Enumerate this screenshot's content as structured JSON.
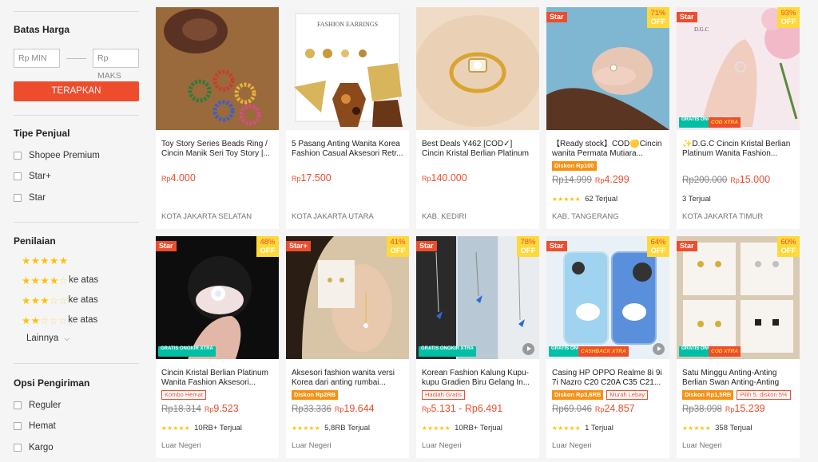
{
  "sidebar": {
    "price_section": {
      "title": "Batas Harga",
      "min_placeholder": "Rp MIN",
      "max_placeholder": "Rp MAKS",
      "apply_label": "TERAPKAN"
    },
    "seller_section": {
      "title": "Tipe Penjual",
      "options": [
        "Shopee Premium",
        "Star+",
        "Star"
      ]
    },
    "rating_section": {
      "title": "Penilaian",
      "options": [
        {
          "stars": 5,
          "suffix": ""
        },
        {
          "stars": 4,
          "suffix": "ke atas"
        },
        {
          "stars": 3,
          "suffix": "ke atas"
        },
        {
          "stars": 2,
          "suffix": "ke atas"
        }
      ],
      "more_label": "Lainnya"
    },
    "shipping_section": {
      "title": "Opsi Pengiriman",
      "options": [
        "Reguler",
        "Hemat",
        "Kargo"
      ]
    }
  },
  "products": [
    {
      "title": "Toy Story Series Beads Ring / Cincin Manik Seri Toy Story |...",
      "price": "4.000",
      "old_price": "",
      "currency": "Rp",
      "location": "KOTA JAKARTA SELATAN",
      "seller_badge": "",
      "discount": "",
      "discount_suffix": "",
      "tags": [],
      "sold": "",
      "rating_stars": 0,
      "free_shipping": false,
      "cod_tag": "",
      "has_video": false
    },
    {
      "title": "5 Pasang Anting Wanita Korea Fashion Casual Aksesori Retr...",
      "price": "17.500",
      "old_price": "",
      "currency": "Rp",
      "location": "KOTA JAKARTA UTARA",
      "seller_badge": "",
      "discount": "",
      "discount_suffix": "",
      "tags": [],
      "sold": "",
      "rating_stars": 0,
      "free_shipping": false,
      "cod_tag": "",
      "has_video": false,
      "image_text": "FASHION EARRINGS"
    },
    {
      "title": "Best Deals Y462 [COD✓] Cincin Kristal Berlian Platinum Wanit...",
      "price": "140.000",
      "old_price": "",
      "currency": "Rp",
      "location": "KAB. KEDIRI",
      "seller_badge": "",
      "discount": "",
      "discount_suffix": "",
      "tags": [],
      "sold": "",
      "rating_stars": 0,
      "free_shipping": false,
      "cod_tag": "",
      "has_video": false
    },
    {
      "title": "【Ready stock】COD🟡Cincin wanita Permata Mutiara...",
      "price": "4.299",
      "old_price": "Rp14.999",
      "currency": "Rp",
      "location": "KAB. TANGERANG",
      "seller_badge": "Star",
      "discount": "71%",
      "discount_suffix": "OFF",
      "tags": [
        {
          "text": "Diskon Rp100",
          "style": "fill"
        }
      ],
      "sold": "62 Terjual",
      "rating_stars": 5,
      "free_shipping": false,
      "cod_tag": "",
      "has_video": false
    },
    {
      "title": "✨D.G.C Cincin Kristal Berlian Platinum Wanita Fashion...",
      "price": "15.000",
      "old_price": "Rp200.000",
      "currency": "Rp",
      "location": "KOTA JAKARTA TIMUR",
      "seller_badge": "Star",
      "discount": "93%",
      "discount_suffix": "OFF",
      "tags": [],
      "sold": "3 Terjual",
      "rating_stars": 0,
      "free_shipping": true,
      "cod_tag": "COD XTRA",
      "has_video": false,
      "image_text": "D.G.C"
    },
    {
      "title": "Cincin Kristal Berlian Platinum Wanita Fashion Aksesori...",
      "price": "9.523",
      "old_price": "Rp18.314",
      "currency": "Rp",
      "location": "Luar Negeri",
      "seller_badge": "Star",
      "discount": "48%",
      "discount_suffix": "OFF",
      "tags": [
        {
          "text": "Kombo Hemat",
          "style": "outline"
        }
      ],
      "sold": "10RB+ Terjual",
      "rating_stars": 5,
      "free_shipping": true,
      "cod_tag": "",
      "has_video": false
    },
    {
      "title": "Aksesori fashion wanita versi Korea dari anting rumbai...",
      "price": "19.644",
      "old_price": "Rp33.336",
      "currency": "Rp",
      "location": "Luar Negeri",
      "seller_badge": "Star+",
      "discount": "41%",
      "discount_suffix": "OFF",
      "tags": [
        {
          "text": "Diskon Rp2RB",
          "style": "fill"
        }
      ],
      "sold": "5,8RB Terjual",
      "rating_stars": 5,
      "free_shipping": false,
      "cod_tag": "",
      "has_video": false
    },
    {
      "title": "Korean Fashion Kalung Kupu-kupu Gradien Biru Gelang In...",
      "price": "5.131 - Rp6.491",
      "old_price": "",
      "currency": "Rp",
      "location": "Luar Negeri",
      "seller_badge": "Star",
      "discount": "78%",
      "discount_suffix": "OFF",
      "tags": [
        {
          "text": "Hadiah Gratis",
          "style": "outline"
        }
      ],
      "sold": "10RB+ Terjual",
      "rating_stars": 5,
      "free_shipping": true,
      "cod_tag": "",
      "has_video": true
    },
    {
      "title": "Casing HP OPPO Realme 8i 9i 7i Nazro C20 C20A C35 C21...",
      "price": "24.857",
      "old_price": "Rp69.046",
      "currency": "Rp",
      "location": "Luar Negeri",
      "seller_badge": "Star",
      "discount": "64%",
      "discount_suffix": "OFF",
      "tags": [
        {
          "text": "Diskon Rp3,6RB",
          "style": "fill"
        },
        {
          "text": "Murah Lebay",
          "style": "outline"
        }
      ],
      "sold": "1 Terjual",
      "rating_stars": 5,
      "free_shipping": true,
      "cod_tag": "CASHBACK XTRA",
      "has_video": true
    },
    {
      "title": "Satu Minggu Anting-Anting Berlian Swan Anting-Anting Se...",
      "price": "15.239",
      "old_price": "Rp38.098",
      "currency": "Rp",
      "location": "Luar Negeri",
      "seller_badge": "Star",
      "discount": "60%",
      "discount_suffix": "OFF",
      "tags": [
        {
          "text": "Diskon Rp1,5RB",
          "style": "fill"
        },
        {
          "text": "Pilih 5, diskon 5%",
          "style": "outline"
        }
      ],
      "sold": "358 Terjual",
      "rating_stars": 5,
      "free_shipping": true,
      "cod_tag": "COD XTRA",
      "has_video": false
    }
  ],
  "free_shipping_label": "GRATIS ONGKIR XTRA",
  "colors": {
    "accent": "#ee4d2d",
    "discount_badge": "#ffd839",
    "star": "#ffc107",
    "free_shipping": "#00bfa5"
  }
}
